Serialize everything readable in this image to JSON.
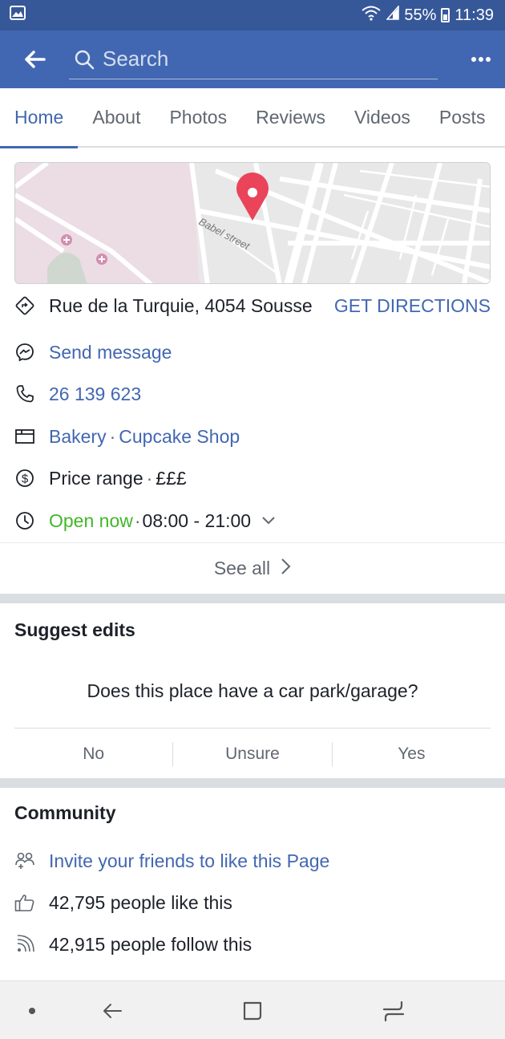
{
  "status_bar": {
    "battery": "55%",
    "time": "11:39",
    "icons": [
      "image-icon",
      "wifi-icon",
      "signal-icon",
      "battery-icon"
    ]
  },
  "app_bar": {
    "search_placeholder": "Search",
    "icons": [
      "back-arrow-icon",
      "search-icon",
      "more-icon"
    ]
  },
  "tabs": [
    {
      "label": "Home",
      "active": true
    },
    {
      "label": "About",
      "active": false
    },
    {
      "label": "Photos",
      "active": false
    },
    {
      "label": "Reviews",
      "active": false
    },
    {
      "label": "Videos",
      "active": false
    },
    {
      "label": "Posts",
      "active": false
    }
  ],
  "map": {
    "street_label": "Babel street"
  },
  "info": {
    "address": "Rue de la Turquie, 4054 Sousse",
    "directions": "GET DIRECTIONS",
    "message": "Send message",
    "phone": "26 139 623",
    "category_1": "Bakery",
    "category_sep": "·",
    "category_2": "Cupcake Shop",
    "price_label": "Price range",
    "price_sep": "·",
    "price_value": "£££",
    "open_status": "Open now",
    "hours_sep": "·",
    "hours": "08:00 - 21:00"
  },
  "see_all": "See all",
  "suggest_edits": {
    "title": "Suggest edits",
    "question": "Does this place have a car park/garage?",
    "answers": [
      "No",
      "Unsure",
      "Yes"
    ]
  },
  "community": {
    "title": "Community",
    "invite": "Invite your friends to like this Page",
    "likes": "42,795 people like this",
    "follows": "42,915 people follow this"
  },
  "colors": {
    "status_bar": "#365899",
    "app_bar": "#4267b2",
    "link": "#4267b2",
    "open_green": "#42b72a",
    "map_pin": "#e9445a"
  }
}
